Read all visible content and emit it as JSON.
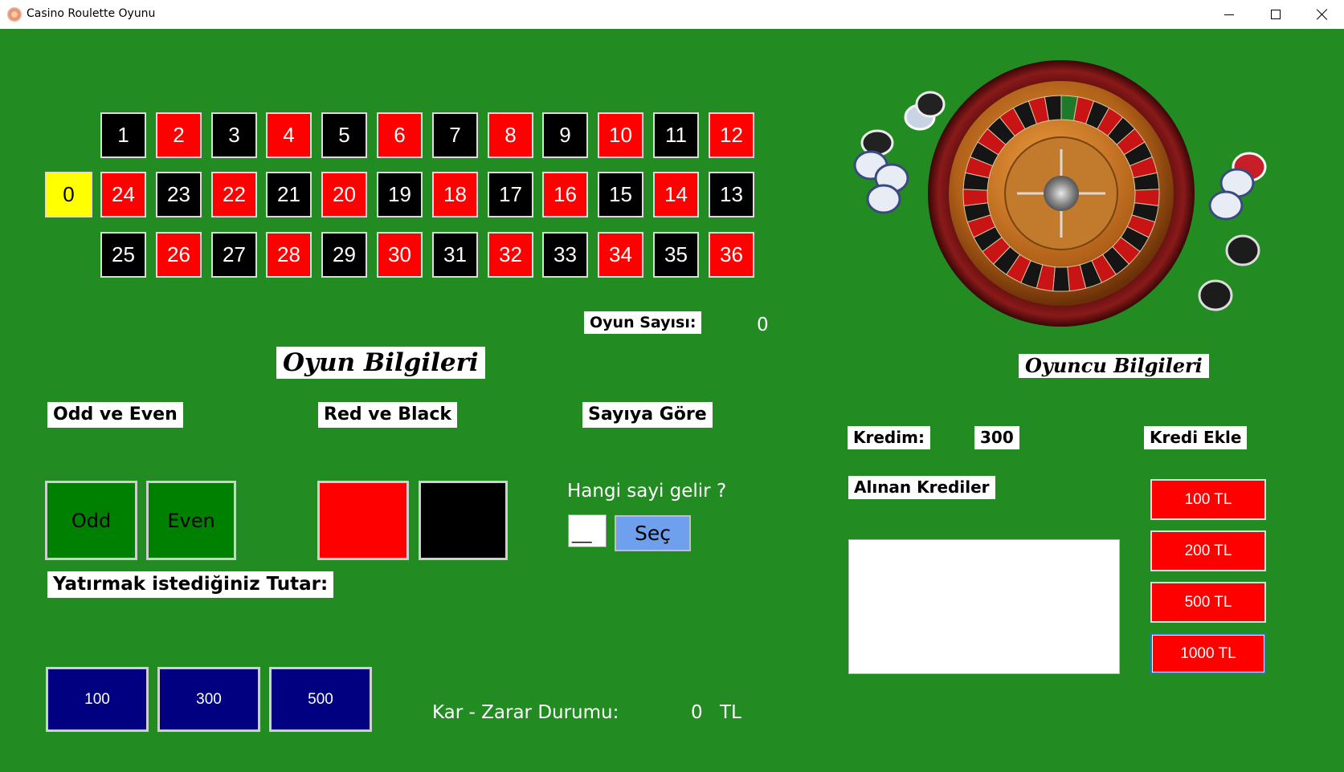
{
  "window": {
    "title": "Casino Roulette Oyunu"
  },
  "board": {
    "zero": "0",
    "rows": [
      [
        [
          "1",
          "black"
        ],
        [
          "2",
          "red"
        ],
        [
          "3",
          "black"
        ],
        [
          "4",
          "red"
        ],
        [
          "5",
          "black"
        ],
        [
          "6",
          "red"
        ],
        [
          "7",
          "black"
        ],
        [
          "8",
          "red"
        ],
        [
          "9",
          "black"
        ],
        [
          "10",
          "red"
        ],
        [
          "11",
          "black"
        ],
        [
          "12",
          "red"
        ]
      ],
      [
        [
          "24",
          "red"
        ],
        [
          "23",
          "black"
        ],
        [
          "22",
          "red"
        ],
        [
          "21",
          "black"
        ],
        [
          "20",
          "red"
        ],
        [
          "19",
          "black"
        ],
        [
          "18",
          "red"
        ],
        [
          "17",
          "black"
        ],
        [
          "16",
          "red"
        ],
        [
          "15",
          "black"
        ],
        [
          "14",
          "red"
        ],
        [
          "13",
          "black"
        ]
      ],
      [
        [
          "25",
          "black"
        ],
        [
          "26",
          "red"
        ],
        [
          "27",
          "black"
        ],
        [
          "28",
          "red"
        ],
        [
          "29",
          "black"
        ],
        [
          "30",
          "red"
        ],
        [
          "31",
          "black"
        ],
        [
          "32",
          "red"
        ],
        [
          "33",
          "black"
        ],
        [
          "34",
          "red"
        ],
        [
          "35",
          "black"
        ],
        [
          "36",
          "red"
        ]
      ]
    ]
  },
  "game": {
    "count_label": "Oyun Sayısı:",
    "count_value": "0",
    "info_title": "Oyun Bilgileri",
    "odd_even_label": "Odd ve Even",
    "odd_label": "Odd",
    "even_label": "Even",
    "red_black_label": "Red ve Black",
    "number_label": "Sayıya Göre",
    "number_question": "Hangi sayi gelir ?",
    "number_input_value": "__",
    "select_label": "Seç",
    "amount_label": "Yatırmak istediğiniz Tutar:",
    "amounts": [
      "100",
      "300",
      "500"
    ],
    "profit_label": "Kar - Zarar Durumu:",
    "profit_value": "0",
    "profit_currency": "TL"
  },
  "player": {
    "info_title": "Oyuncu Bilgileri",
    "credit_label": "Kredim:",
    "credit_value": "300",
    "add_credit_label": "Kredi Ekle",
    "received_label": "Alınan Krediler",
    "credit_buttons": [
      "100 TL",
      "200 TL",
      "500 TL",
      "1000 TL"
    ]
  },
  "colors": {
    "table": "#228b22",
    "red": "#ff0000",
    "black": "#000000",
    "zero": "#ffff00",
    "navy": "#000080",
    "select": "#6ea0ee"
  }
}
